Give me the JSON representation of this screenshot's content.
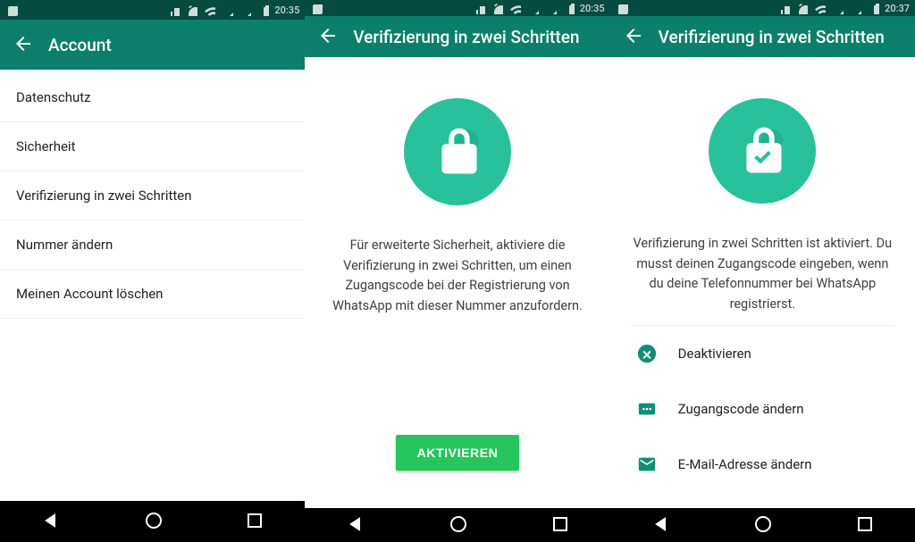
{
  "status": {
    "time_a": "20:35",
    "time_b": "20:35",
    "time_c": "20:37"
  },
  "panel1": {
    "title": "Account",
    "items": [
      {
        "label": "Datenschutz"
      },
      {
        "label": "Sicherheit"
      },
      {
        "label": "Verifizierung in zwei Schritten"
      },
      {
        "label": "Nummer ändern"
      },
      {
        "label": "Meinen Account löschen"
      }
    ]
  },
  "panel2": {
    "title": "Verifizierung in zwei Schritten",
    "desc": "Für erweiterte Sicherheit, aktiviere die Verifizierung in zwei Schritten, um einen Zugangscode bei der Registrierung von WhatsApp mit dieser Nummer anzufordern.",
    "button": "AKTIVIEREN"
  },
  "panel3": {
    "title": "Verifizierung in zwei Schritten",
    "desc": "Verifizierung in zwei Schritten ist aktiviert. Du musst deinen Zugangscode eingeben, wenn du deine Telefonnummer bei WhatsApp registrierst.",
    "options": [
      {
        "label": "Deaktivieren"
      },
      {
        "label": "Zugangscode ändern"
      },
      {
        "label": "E-Mail-Adresse ändern"
      }
    ]
  }
}
